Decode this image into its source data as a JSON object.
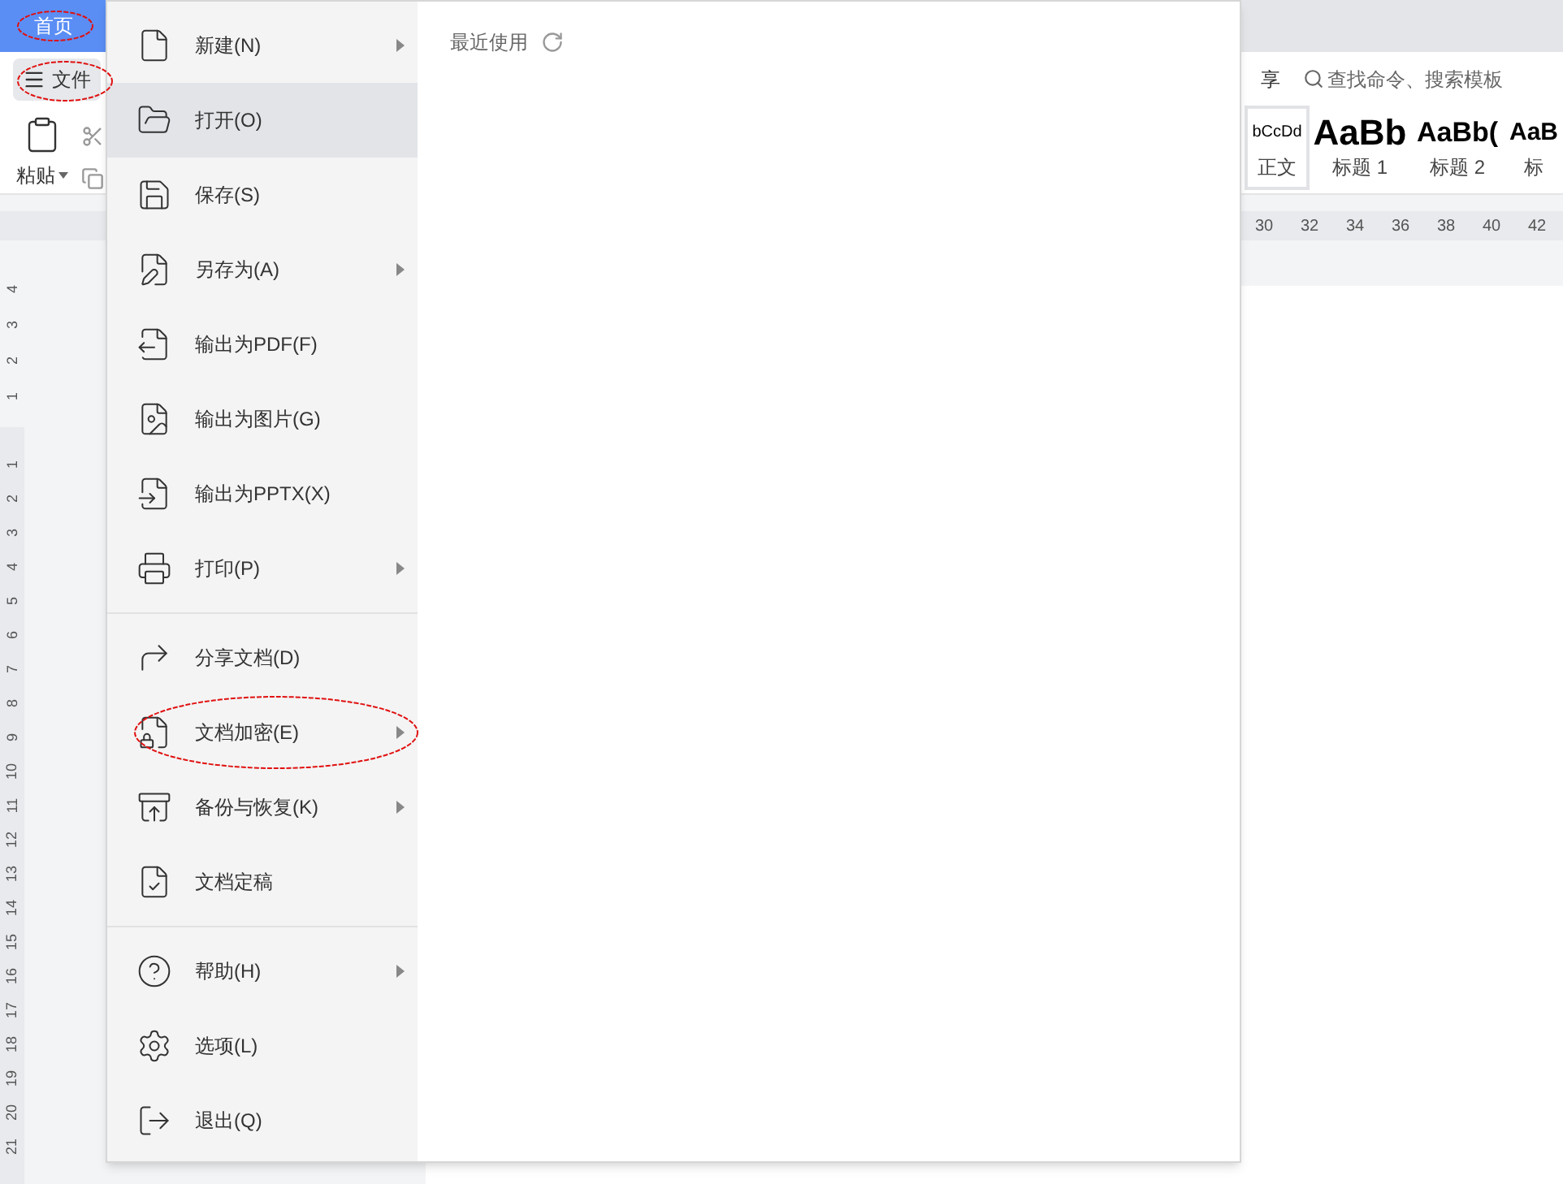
{
  "tab_bar": {
    "home_tab": {
      "label": "首页",
      "selected": true
    }
  },
  "toolbar": {
    "file_button": "文件",
    "share_text": "享",
    "search": {
      "placeholder": "查找命令、搜索模板"
    }
  },
  "ribbon": {
    "paste": "粘贴",
    "styles": [
      {
        "sample": "bCcDd",
        "name": "正文",
        "kind": "normal"
      },
      {
        "sample": "AaBb",
        "name": "标题 1",
        "kind": "h1"
      },
      {
        "sample": "AaBb(",
        "name": "标题 2",
        "kind": "h2"
      },
      {
        "sample": "AaB",
        "name": "标",
        "kind": "h3"
      }
    ]
  },
  "ruler": {
    "marks": [
      "30",
      "32",
      "34",
      "36",
      "38",
      "40",
      "42"
    ]
  },
  "vertical_ruler": {
    "top_marks": [
      "4",
      "3",
      "2",
      "1"
    ],
    "marks": [
      "1",
      "2",
      "3",
      "4",
      "5",
      "6",
      "7",
      "8",
      "9",
      "10",
      "11",
      "12",
      "13",
      "14",
      "15",
      "16",
      "17",
      "18",
      "19",
      "20",
      "21"
    ]
  },
  "file_menu": {
    "groups": [
      [
        {
          "label": "新建(N)",
          "submenu": true,
          "selected": false
        },
        {
          "label": "打开(O)",
          "submenu": false,
          "selected": true
        },
        {
          "label": "保存(S)",
          "submenu": false,
          "selected": false
        },
        {
          "label": "另存为(A)",
          "submenu": true,
          "selected": false
        },
        {
          "label": "输出为PDF(F)",
          "submenu": false,
          "selected": false
        },
        {
          "label": "输出为图片(G)",
          "submenu": false,
          "selected": false
        },
        {
          "label": "输出为PPTX(X)",
          "submenu": false,
          "selected": false
        },
        {
          "label": "打印(P)",
          "submenu": true,
          "selected": false
        }
      ],
      [
        {
          "label": "分享文档(D)",
          "submenu": false,
          "selected": false
        },
        {
          "label": "文档加密(E)",
          "submenu": true,
          "selected": false
        },
        {
          "label": "备份与恢复(K)",
          "submenu": true,
          "selected": false
        },
        {
          "label": "文档定稿",
          "submenu": false,
          "selected": false
        }
      ],
      [
        {
          "label": "帮助(H)",
          "submenu": true,
          "selected": false
        },
        {
          "label": "选项(L)",
          "submenu": false,
          "selected": false
        },
        {
          "label": "退出(Q)",
          "submenu": false,
          "selected": false
        }
      ]
    ],
    "recent": {
      "title": "最近使用"
    }
  }
}
